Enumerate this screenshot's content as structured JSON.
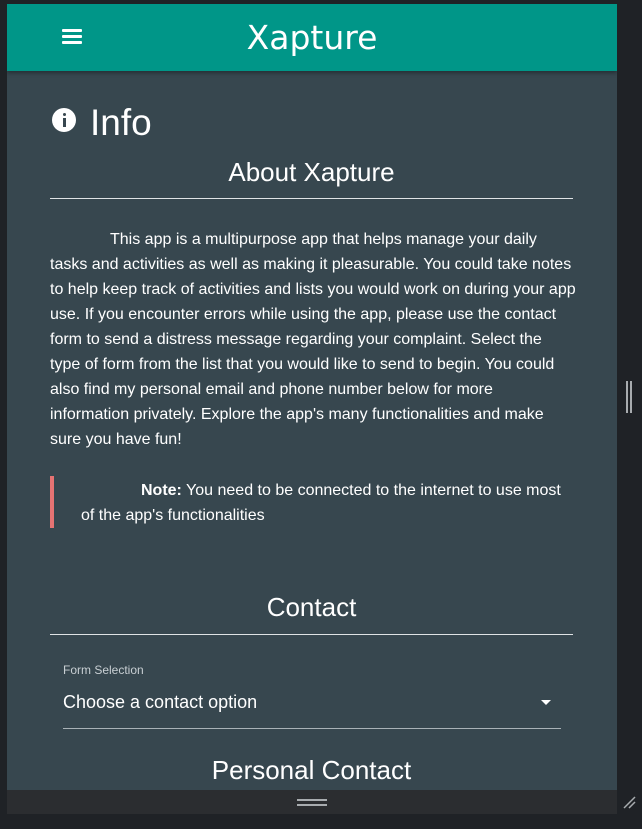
{
  "app": {
    "title": "Xapture",
    "menu_icon": "hamburger-menu-icon"
  },
  "info": {
    "icon": "info-icon",
    "title": "Info"
  },
  "about": {
    "heading": "About Xapture",
    "body": "This app is a multipurpose app that helps manage your daily tasks and activities as well as making it pleasurable. You could take notes to help keep track of activities and lists you would work on during your app use. If you encounter errors while using the app, please use the contact form to send a distress message regarding your complaint. Select the type of form from the list that you would like to send to begin. You could also find my personal email and phone number below for more information privately. Explore the app's many functionalities and make sure you have fun!"
  },
  "note": {
    "label": "Note:",
    "text": " You need to be connected to the internet to use most of the app's functionalities"
  },
  "contact": {
    "heading": "Contact",
    "form_label": "Form Selection",
    "select_value": "Choose a contact option"
  },
  "personal_contact": {
    "heading": "Personal Contact"
  },
  "colors": {
    "appbar": "#009688",
    "background": "#37474f",
    "note_accent": "#e57373"
  }
}
